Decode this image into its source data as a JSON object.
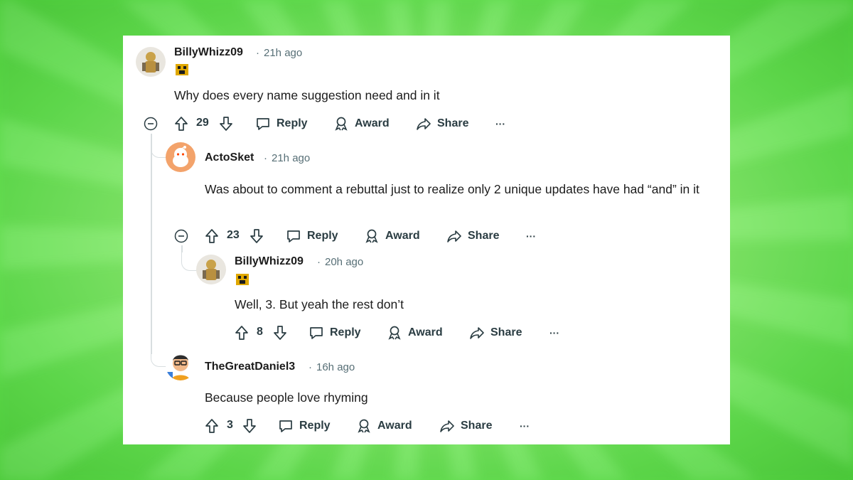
{
  "comments": [
    {
      "username": "BillyWhizz09",
      "time": "21h ago",
      "text": "Why does every name suggestion need and in it",
      "votes": "29",
      "actions": {
        "reply": "Reply",
        "award": "Award",
        "share": "Share",
        "more": "···"
      }
    },
    {
      "username": "ActoSket",
      "time": "21h ago",
      "text": "Was about to comment a rebuttal just to realize only 2 unique updates have had “and” in it",
      "votes": "23",
      "actions": {
        "reply": "Reply",
        "award": "Award",
        "share": "Share",
        "more": "···"
      }
    },
    {
      "username": "BillyWhizz09",
      "time": "20h ago",
      "text": "Well, 3. But yeah the rest don’t",
      "votes": "8",
      "actions": {
        "reply": "Reply",
        "award": "Award",
        "share": "Share",
        "more": "···"
      }
    },
    {
      "username": "TheGreatDaniel3",
      "time": "16h ago",
      "text": "Because people love rhyming",
      "votes": "3",
      "actions": {
        "reply": "Reply",
        "award": "Award",
        "share": "Share",
        "more": "···"
      }
    }
  ],
  "colors": {
    "background": "#66e352",
    "card": "#ffffff",
    "text": "#1c1c1c",
    "meta": "#576f76",
    "thread": "#d8dee0"
  }
}
